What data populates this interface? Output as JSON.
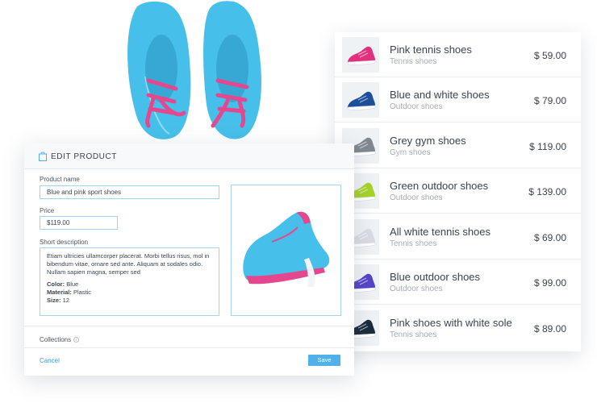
{
  "edit_product": {
    "title": "EDIT PRODUCT",
    "name_label": "Product name",
    "name_value": "Blue and pink sport shoes",
    "price_label": "Price",
    "price_value": "$119.00",
    "description_label": "Short description",
    "description_text": "Etiam ultricies ullamcorper placerat. Morbi tellus risus, mol in bibendum vitae, ornare sed ante. Aliquam at sodales odio. Nullam sapien magna, semper sed",
    "attributes": [
      {
        "label": "Color:",
        "value": "Blue"
      },
      {
        "label": "Material:",
        "value": "Plastic"
      },
      {
        "label": "Size:",
        "value": "12"
      }
    ],
    "collections_label": "Collections",
    "cancel_label": "Cancel",
    "save_label": "Save"
  },
  "product_list": [
    {
      "name": "Pink tennis shoes",
      "category": "Tennis shoes",
      "price": "$ 59.00",
      "color": "#e0307f"
    },
    {
      "name": "Blue and white shoes",
      "category": "Outdoor shoes",
      "price": "$ 79.00",
      "color": "#1f4f9a"
    },
    {
      "name": "Grey gym shoes",
      "category": "Gym shoes",
      "price": "$ 119.00",
      "color": "#808890"
    },
    {
      "name": "Green outdoor shoes",
      "category": "Outdoor shoes",
      "price": "$ 139.00",
      "color": "#a6d32a"
    },
    {
      "name": "All white tennis shoes",
      "category": "Tennis shoes",
      "price": "$ 69.00",
      "color": "#d9dde2"
    },
    {
      "name": "Blue outdoor shoes",
      "category": "Outdoor shoes",
      "price": "$ 99.00",
      "color": "#5545c8"
    },
    {
      "name": "Pink shoes with white sole",
      "category": "Tennis shoes",
      "price": "$ 89.00",
      "color": "#1c2c3c"
    }
  ],
  "colors": {
    "accent": "#4fb0ea",
    "shoe_blue": "#45c1ea",
    "lace_pink": "#e5478e"
  }
}
